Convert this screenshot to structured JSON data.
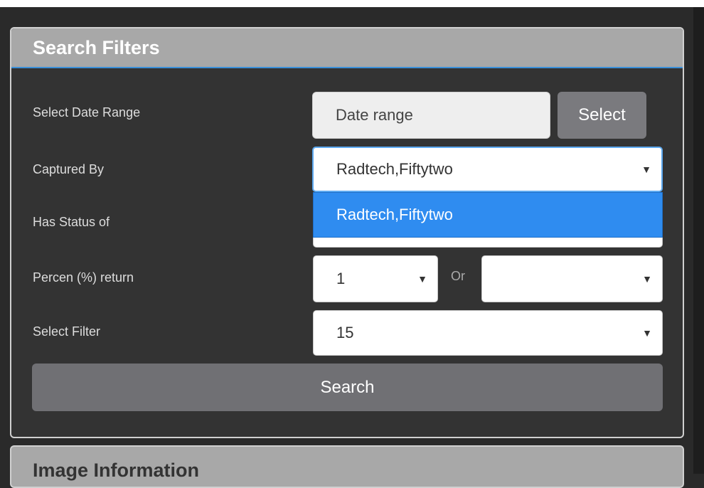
{
  "search_filters": {
    "title": "Search Filters",
    "labels": {
      "date_range": "Select Date Range",
      "captured_by": "Captured By",
      "status": "Has Status of",
      "percent_return": "Percen (%) return",
      "select_filter": "Select Filter"
    },
    "date_range_placeholder": "Date range",
    "select_button": "Select",
    "captured_by_value": "Radtech,Fiftytwo",
    "captured_by_options": [
      "Radtech,Fiftytwo"
    ],
    "percent_return_value": "1",
    "or_label": "Or",
    "percent_return_alt_value": "",
    "select_filter_value": "15",
    "search_button": "Search",
    "caret_icon": "▼"
  },
  "image_information": {
    "title": "Image Information"
  },
  "colors": {
    "accent": "#2f8cf0",
    "header_bg": "#a8a8a8",
    "panel_bg": "#333333"
  }
}
